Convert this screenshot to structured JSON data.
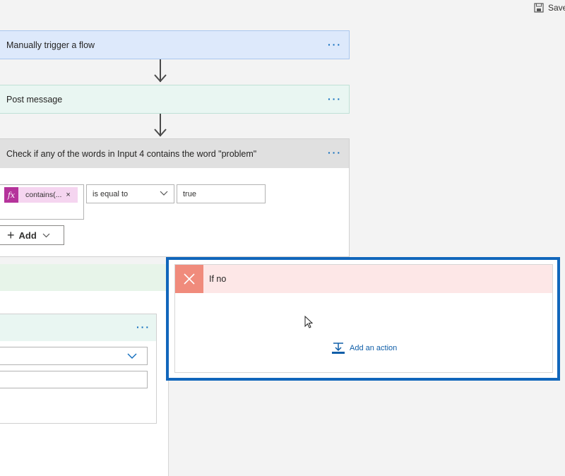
{
  "toolbar": {
    "save_label": "Save"
  },
  "steps": {
    "trigger": {
      "title": "Manually trigger a flow"
    },
    "post": {
      "title": "Post message"
    },
    "condition": {
      "title": "Check if any of the words in Input 4 contains the word \"problem\"",
      "token_label": "contains(...",
      "token_icon": "fx",
      "operator": "is equal to",
      "value": "true",
      "add_label": "Add"
    }
  },
  "if_no": {
    "title": "If no",
    "add_action_label": "Add an action"
  },
  "colors": {
    "trigger_header": "#dde9fb",
    "post_header": "#e9f6f2",
    "condition_header": "#e0e0e0",
    "if_no_header": "#fde7e7",
    "if_no_icon": "#f08b7c",
    "if_yes_header": "#e7f4e9",
    "highlight_border": "#1166bb",
    "token_bg": "#f5d5f0",
    "token_icon_bg": "#b5339b"
  }
}
